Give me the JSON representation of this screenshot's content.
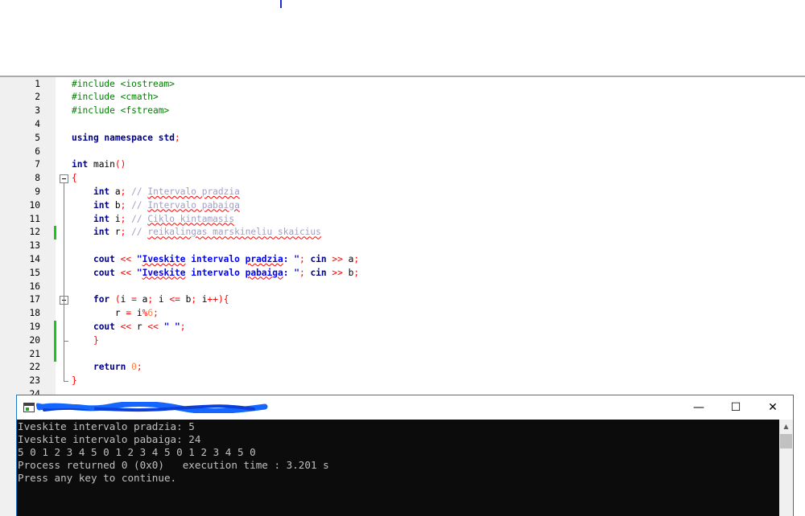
{
  "editor": {
    "lines": [
      {
        "n": "1",
        "tokens": [
          {
            "t": "#include <iostream>",
            "c": "pp"
          }
        ]
      },
      {
        "n": "2",
        "tokens": [
          {
            "t": "#include <cmath>",
            "c": "pp"
          }
        ]
      },
      {
        "n": "3",
        "tokens": [
          {
            "t": "#include <fstream>",
            "c": "pp"
          }
        ]
      },
      {
        "n": "4",
        "tokens": []
      },
      {
        "n": "5",
        "tokens": [
          {
            "t": "using namespace std",
            "c": "kw"
          },
          {
            "t": ";",
            "c": "pn"
          }
        ]
      },
      {
        "n": "6",
        "tokens": []
      },
      {
        "n": "7",
        "tokens": [
          {
            "t": "int",
            "c": "kw"
          },
          {
            "t": " main",
            "c": "ex"
          },
          {
            "t": "()",
            "c": "pn"
          }
        ],
        "fold": "start"
      },
      {
        "n": "8",
        "tokens": [
          {
            "t": "{",
            "c": "pn"
          }
        ],
        "fold": "box"
      },
      {
        "n": "9",
        "tokens": [
          {
            "t": "    ",
            "c": "ex"
          },
          {
            "t": "int",
            "c": "kw"
          },
          {
            "t": " a",
            "c": "ex"
          },
          {
            "t": ";",
            "c": "pn"
          },
          {
            "t": " // ",
            "c": "cm"
          },
          {
            "t": "Intervalo pradzia",
            "c": "cm sq"
          }
        ]
      },
      {
        "n": "10",
        "tokens": [
          {
            "t": "    ",
            "c": "ex"
          },
          {
            "t": "int",
            "c": "kw"
          },
          {
            "t": " b",
            "c": "ex"
          },
          {
            "t": ";",
            "c": "pn"
          },
          {
            "t": " // ",
            "c": "cm"
          },
          {
            "t": "Intervalo pabaiga",
            "c": "cm sq"
          }
        ]
      },
      {
        "n": "11",
        "tokens": [
          {
            "t": "    ",
            "c": "ex"
          },
          {
            "t": "int",
            "c": "kw"
          },
          {
            "t": " i",
            "c": "ex"
          },
          {
            "t": ";",
            "c": "pn"
          },
          {
            "t": " // ",
            "c": "cm"
          },
          {
            "t": "Ciklo kintamasis",
            "c": "cm sq"
          }
        ]
      },
      {
        "n": "12",
        "tokens": [
          {
            "t": "    ",
            "c": "ex"
          },
          {
            "t": "int",
            "c": "kw"
          },
          {
            "t": " r",
            "c": "ex"
          },
          {
            "t": ";",
            "c": "pn"
          },
          {
            "t": " // ",
            "c": "cm"
          },
          {
            "t": "reikalingas marskineliu skaicius",
            "c": "cm sq"
          }
        ],
        "changed": true
      },
      {
        "n": "13",
        "tokens": []
      },
      {
        "n": "14",
        "tokens": [
          {
            "t": "    ",
            "c": "ex"
          },
          {
            "t": "cout",
            "c": "kw"
          },
          {
            "t": " << ",
            "c": "pn"
          },
          {
            "t": "\"",
            "c": "str"
          },
          {
            "t": "Iveskite",
            "c": "str sq"
          },
          {
            "t": " intervalo ",
            "c": "str"
          },
          {
            "t": "pradzia",
            "c": "str sq"
          },
          {
            "t": ": \"",
            "c": "str"
          },
          {
            "t": "; ",
            "c": "pn"
          },
          {
            "t": "cin",
            "c": "kw"
          },
          {
            "t": " >> ",
            "c": "pn"
          },
          {
            "t": "a",
            "c": "ex"
          },
          {
            "t": ";",
            "c": "pn"
          }
        ]
      },
      {
        "n": "15",
        "tokens": [
          {
            "t": "    ",
            "c": "ex"
          },
          {
            "t": "cout",
            "c": "kw"
          },
          {
            "t": " << ",
            "c": "pn"
          },
          {
            "t": "\"",
            "c": "str"
          },
          {
            "t": "Iveskite",
            "c": "str sq"
          },
          {
            "t": " intervalo ",
            "c": "str"
          },
          {
            "t": "pabaiga",
            "c": "str sq"
          },
          {
            "t": ": \"",
            "c": "str"
          },
          {
            "t": "; ",
            "c": "pn"
          },
          {
            "t": "cin",
            "c": "kw"
          },
          {
            "t": " >> ",
            "c": "pn"
          },
          {
            "t": "b",
            "c": "ex"
          },
          {
            "t": ";",
            "c": "pn"
          }
        ]
      },
      {
        "n": "16",
        "tokens": []
      },
      {
        "n": "17",
        "tokens": [
          {
            "t": "    ",
            "c": "ex"
          },
          {
            "t": "for",
            "c": "kw"
          },
          {
            "t": " (",
            "c": "pn"
          },
          {
            "t": "i ",
            "c": "ex"
          },
          {
            "t": "=",
            "c": "pn"
          },
          {
            "t": " a",
            "c": "ex"
          },
          {
            "t": "; ",
            "c": "pn"
          },
          {
            "t": "i ",
            "c": "ex"
          },
          {
            "t": "<=",
            "c": "pn"
          },
          {
            "t": " b",
            "c": "ex"
          },
          {
            "t": "; ",
            "c": "pn"
          },
          {
            "t": "i",
            "c": "ex"
          },
          {
            "t": "++){",
            "c": "pn"
          }
        ],
        "fold": "box"
      },
      {
        "n": "18",
        "tokens": [
          {
            "t": "        r ",
            "c": "ex"
          },
          {
            "t": "=",
            "c": "pn"
          },
          {
            "t": " i",
            "c": "ex"
          },
          {
            "t": "%",
            "c": "pn"
          },
          {
            "t": "6",
            "c": "num"
          },
          {
            "t": ";",
            "c": "pn"
          }
        ]
      },
      {
        "n": "19",
        "tokens": [
          {
            "t": "    ",
            "c": "ex"
          },
          {
            "t": "cout",
            "c": "kw"
          },
          {
            "t": " << ",
            "c": "pn"
          },
          {
            "t": "r",
            "c": "ex"
          },
          {
            "t": " << ",
            "c": "pn"
          },
          {
            "t": "\" \"",
            "c": "str"
          },
          {
            "t": ";",
            "c": "pn"
          }
        ],
        "changed": true
      },
      {
        "n": "20",
        "tokens": [
          {
            "t": "    ",
            "c": "ex"
          },
          {
            "t": "}",
            "c": "pn"
          }
        ],
        "changed": true,
        "fold": "end-inner"
      },
      {
        "n": "21",
        "tokens": [],
        "changed": true
      },
      {
        "n": "22",
        "tokens": [
          {
            "t": "    ",
            "c": "ex"
          },
          {
            "t": "return",
            "c": "kw"
          },
          {
            "t": " ",
            "c": "ex"
          },
          {
            "t": "0",
            "c": "num"
          },
          {
            "t": ";",
            "c": "pn"
          }
        ]
      },
      {
        "n": "23",
        "tokens": [
          {
            "t": "}",
            "c": "pn"
          }
        ],
        "fold": "end-outer"
      },
      {
        "n": "24",
        "tokens": []
      }
    ]
  },
  "console": {
    "title_icon": "console-window-icon",
    "minimize_label": "—",
    "maximize_label": "☐",
    "close_label": "✕",
    "output_lines": [
      "Iveskite intervalo pradzia: 5",
      "Iveskite intervalo pabaiga: 24",
      "5 0 1 2 3 4 5 0 1 2 3 4 5 0 1 2 3 4 5 0",
      "Process returned 0 (0x0)   execution time : 3.201 s",
      "Press any key to continue."
    ],
    "scroll_up_glyph": "▲"
  },
  "colors": {
    "preprocessor": "#008000",
    "keyword": "#00008b",
    "string": "#0000ff",
    "number": "#ff8040",
    "comment": "#a0a0c8",
    "operator": "#ff0000",
    "changed_marker": "#18c818",
    "terminal_bg": "#0c0c0c",
    "terminal_text": "#c0c0c0"
  }
}
